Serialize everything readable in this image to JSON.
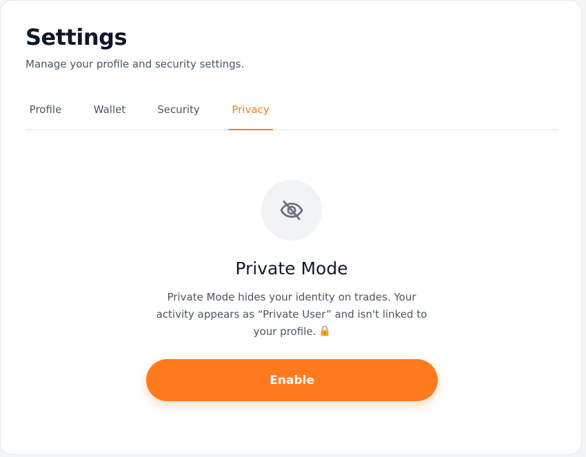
{
  "header": {
    "title": "Settings",
    "subtitle": "Manage your profile and security settings."
  },
  "tabs": [
    {
      "label": "Profile",
      "active": false
    },
    {
      "label": "Wallet",
      "active": false
    },
    {
      "label": "Security",
      "active": false
    },
    {
      "label": "Privacy",
      "active": true
    }
  ],
  "privacy": {
    "icon": "eye-slash-icon",
    "title": "Private Mode",
    "description": "Private Mode hides your identity on trades. Your activity appears as “Private User” and isn't linked to your profile.",
    "lock_icon": "lock-icon",
    "button_label": "Enable"
  },
  "colors": {
    "accent": "#ff7a1f",
    "active_tab": "#f97b1e",
    "title_text": "#0f1729",
    "body_text": "#4b5563",
    "icon_bg": "#f1f3f5"
  }
}
